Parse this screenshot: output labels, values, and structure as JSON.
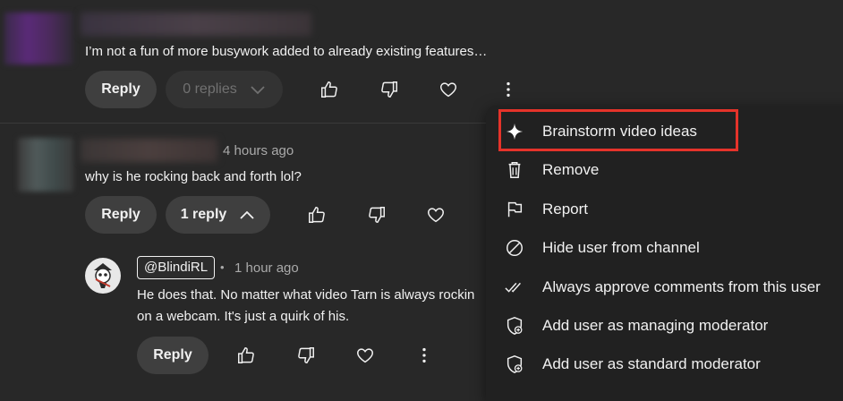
{
  "comments": [
    {
      "text": "I’m not a fun of more busywork added to already existing features…",
      "reply_label": "Reply",
      "replies_label": "0 replies"
    },
    {
      "time": "4 hours ago",
      "text": "why is he rocking back and forth lol?",
      "reply_label": "Reply",
      "replies_label": "1 reply"
    }
  ],
  "reply": {
    "handle": "@BlindiRL",
    "separator": "•",
    "time": "1 hour ago",
    "text_line1": "He does that. No matter what video Tarn is always rockin",
    "text_line2": "on a webcam. It's just a quirk of his.",
    "reply_label": "Reply"
  },
  "menu": {
    "items": [
      {
        "label": "Brainstorm video ideas",
        "icon": "sparkle-icon"
      },
      {
        "label": "Remove",
        "icon": "trash-icon"
      },
      {
        "label": "Report",
        "icon": "flag-icon"
      },
      {
        "label": "Hide user from channel",
        "icon": "block-icon"
      },
      {
        "label": "Always approve comments from this user",
        "icon": "double-check-icon"
      },
      {
        "label": "Add user as managing moderator",
        "icon": "shield-add-icon"
      },
      {
        "label": "Add user as standard moderator",
        "icon": "shield-add-icon"
      }
    ]
  },
  "colors": {
    "background": "#282828",
    "menu_background": "#212121",
    "highlight": "#e5332a"
  }
}
